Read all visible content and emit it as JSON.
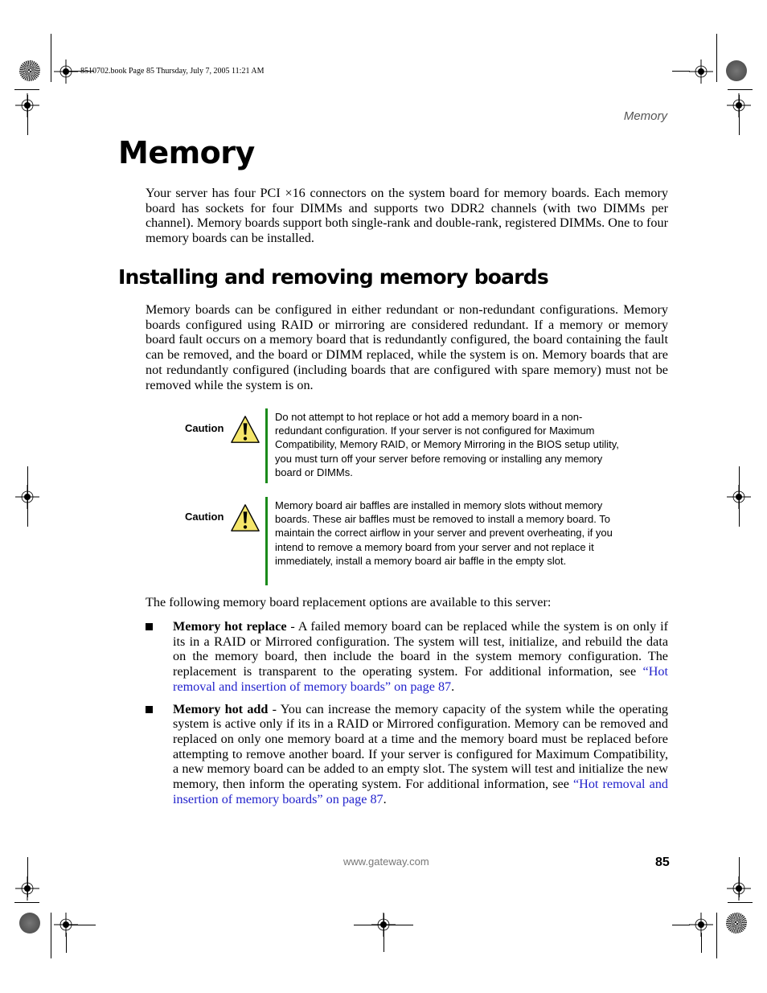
{
  "job_info": "8510702.book  Page 85  Thursday, July 7, 2005  11:21 AM",
  "running_head": "Memory",
  "title": "Memory",
  "intro_paragraph": "Your server has four PCI ×16 connectors on the system board for memory boards. Each memory board has sockets for four DIMMs and supports two DDR2 channels (with two DIMMs per channel). Memory boards support both single-rank and double-rank, registered DIMMs. One to four memory boards can be installed.",
  "section": {
    "heading": "Installing and removing memory boards",
    "paragraph": "Memory boards can be configured in either redundant or non-redundant configurations. Memory boards configured using RAID or mirroring are considered redundant. If a memory or memory board fault occurs on a memory board that is redundantly configured, the board containing the fault can be removed, and the board or DIMM replaced, while the system is on. Memory boards that are not redundantly configured (including boards that are configured with spare memory) must not be removed while the system is on."
  },
  "cautions": [
    {
      "label": "Caution",
      "icon": "warning-triangle-icon",
      "text": "Do not attempt to hot replace or hot add a memory board in a non-redundant configuration. If your server is not configured for Maximum Compatibility, Memory RAID, or Memory Mirroring in the BIOS setup utility, you must turn off your server before removing or installing any memory board or DIMMs."
    },
    {
      "label": "Caution",
      "icon": "warning-triangle-icon",
      "text": "Memory board air baffles are installed in memory slots without memory boards. These air baffles must be removed to install a memory board. To maintain the correct airflow in your server and prevent overheating, if you intend to remove a memory board from your server and not replace it immediately, install a memory board air baffle in the empty slot."
    }
  ],
  "options_intro": "The following memory board replacement options are available to this server:",
  "options": [
    {
      "term": "Memory hot replace",
      "separator": " - ",
      "text": "A failed memory board can be replaced while the system is on only if its in a RAID or Mirrored configuration. The system will test, initialize, and rebuild the data on the memory board, then include the board in the system memory configuration. The replacement is transparent to the operating system. For additional information, see ",
      "link": "“Hot removal and insertion of memory boards” on page 87",
      "after": "."
    },
    {
      "term": "Memory hot add",
      "separator": " - ",
      "text": "You can increase the memory capacity of the system while the operating system is active only if its in a RAID or Mirrored configuration. Memory can be removed and replaced on only one memory board at a time and the memory board must be replaced before attempting to remove another board. If your server is configured for Maximum Compatibility, a new memory board can be added to an empty slot. The system will test and initialize the new memory, then inform the operating system. For additional information, see ",
      "link": "“Hot removal and insertion of memory boards” on page 87",
      "after": "."
    }
  ],
  "footer": {
    "url": "www.gateway.com",
    "page_number": "85"
  },
  "colors": {
    "caution_bar": "#1a8a1a",
    "link": "#2222cc",
    "warning_fill": "#f5e66a"
  }
}
